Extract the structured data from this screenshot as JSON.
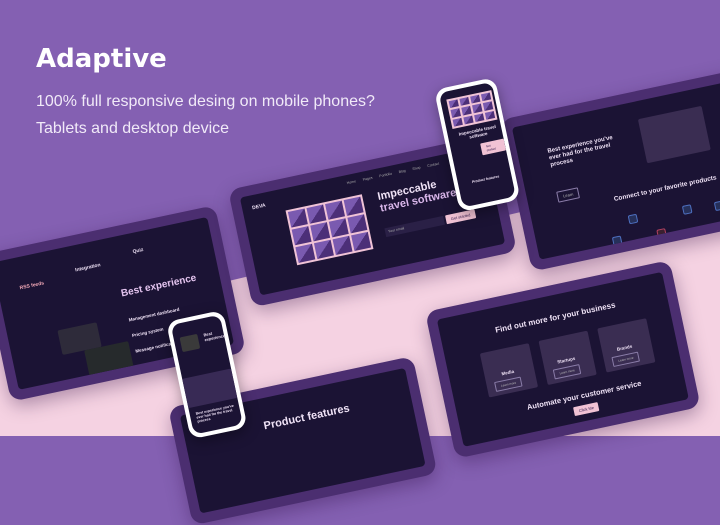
{
  "hero": {
    "title": "Adaptive",
    "line1": "100% full responsive desing on mobile phones?",
    "line2": "Tablets and desktop device"
  },
  "laptop": {
    "logo": "DEVA",
    "nav": [
      "Home",
      "Pages",
      "Portfolio",
      "Blog",
      "Shop",
      "Contact"
    ],
    "headline1": "Impeccable",
    "headline2": "travel software",
    "email_placeholder": "Your email",
    "cta": "Get started"
  },
  "right_tablet": {
    "heading": "Best experience you've ever had for the travel process",
    "button": "Learn",
    "connect": "Connect to your favorite products"
  },
  "left_tablet": {
    "features": [
      "RSS feeds",
      "Integration",
      "Quiz"
    ],
    "heading": "Best experience",
    "items": [
      "Management dashboard",
      "Pricing system",
      "Message notifications"
    ]
  },
  "bottom_tablet": {
    "heading": "Find out more for your business",
    "cards": [
      "Media",
      "Startups",
      "Brands"
    ],
    "card_button": "Learn more",
    "automate": "Automate your customer service",
    "cta": "Click Me"
  },
  "bottom_mid_tablet": {
    "heading": "Product features"
  },
  "phone_top": {
    "headline": "Impeccable travel software",
    "cta": "Get started",
    "section": "Product features"
  },
  "phone_bottom": {
    "heading": "Best experience",
    "subheading": "Best experience you've ever had for the travel process"
  },
  "colors": {
    "bg": "#8460b2",
    "pink": "#f5d2e2",
    "frame": "#4b2e70",
    "screen": "#1b1334",
    "accent": "#f1c2d4"
  }
}
